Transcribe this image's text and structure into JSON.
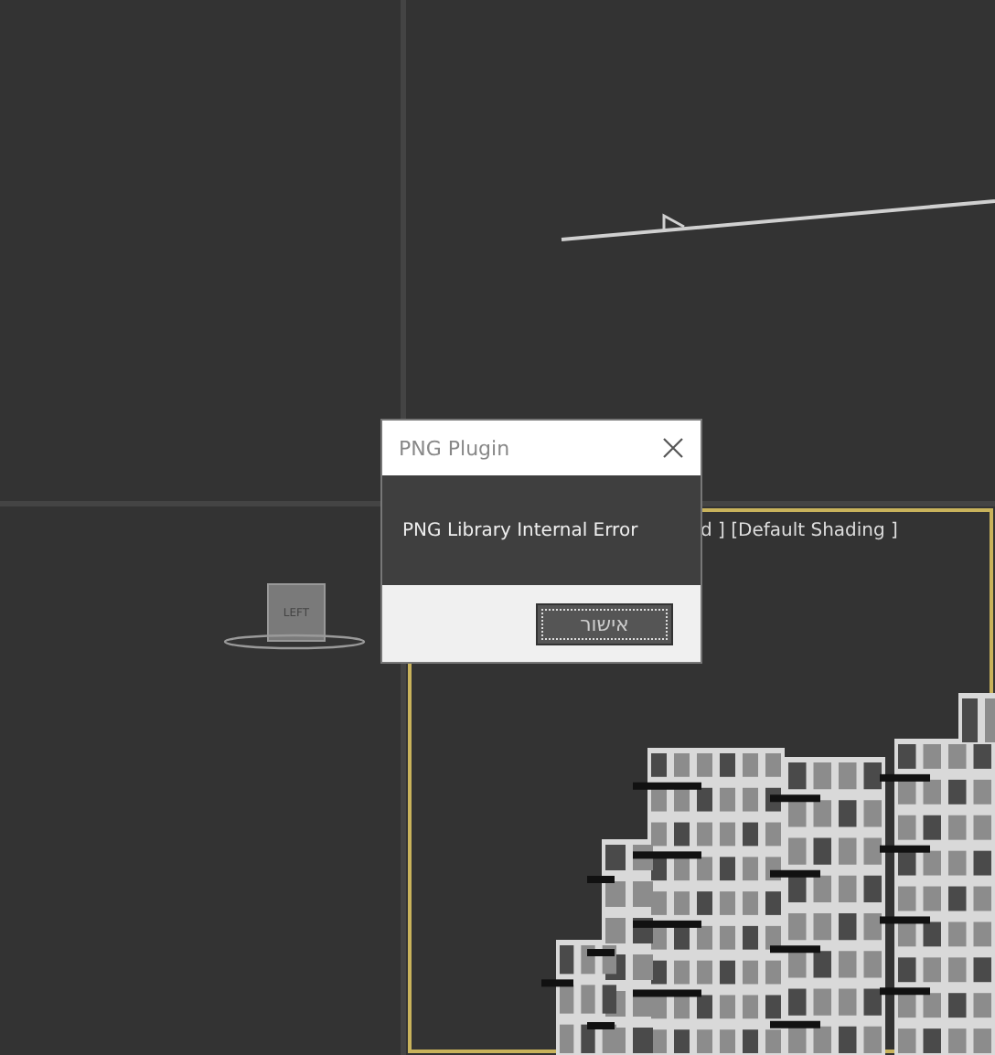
{
  "viewports": [
    {
      "kind": "empty",
      "active": false
    },
    {
      "kind": "line",
      "active": false
    },
    {
      "kind": "cube",
      "active": false,
      "cube_label": "LEFT"
    },
    {
      "kind": "building",
      "active": true,
      "label": "d ] [Default Shading ]"
    }
  ],
  "dialog": {
    "title": "PNG Plugin",
    "message": "PNG Library Internal Error",
    "buttons": [
      {
        "label": "אישור",
        "selected": true
      }
    ]
  }
}
